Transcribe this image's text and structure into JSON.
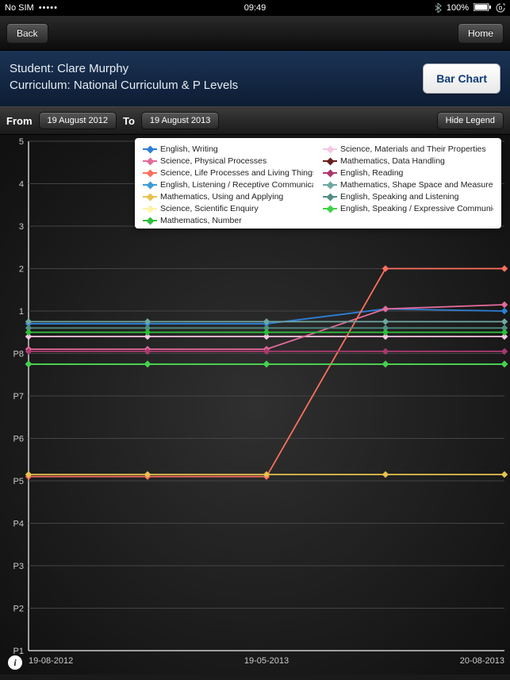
{
  "status": {
    "carrier": "No SIM",
    "time": "09:49",
    "battery": "100%"
  },
  "nav": {
    "back": "Back",
    "home": "Home"
  },
  "header": {
    "student_label": "Student:",
    "student_name": "Clare Murphy",
    "curriculum_label": "Curriculum:",
    "curriculum_name": "National Curriculum & P Levels",
    "bar_chart": "Bar Chart"
  },
  "filter": {
    "from_label": "From",
    "from_date": "19 August 2012",
    "to_label": "To",
    "to_date": "19 August 2013",
    "hide_legend": "Hide Legend"
  },
  "chart_data": {
    "type": "line",
    "ylim": [
      "P1",
      "5"
    ],
    "y_ticks": [
      "P1",
      "P2",
      "P3",
      "P4",
      "P5",
      "P6",
      "P7",
      "P8",
      "1",
      "2",
      "3",
      "4",
      "5"
    ],
    "x_ticks": [
      "19-08-2012",
      "19-05-2013",
      "20-08-2013"
    ],
    "x": [
      0,
      1,
      2,
      3,
      4
    ],
    "series": [
      {
        "name": "English, Writing",
        "color": "#2d7fd6",
        "values": [
          0.7,
          0.7,
          0.7,
          1.05,
          1.0
        ]
      },
      {
        "name": "Science, Materials and Their Properties",
        "color": "#f4c7e2",
        "values": [
          0.4,
          0.4,
          0.4,
          0.4,
          0.4
        ]
      },
      {
        "name": "Science, Physical Processes",
        "color": "#e36b9b",
        "values": [
          0.1,
          0.1,
          0.1,
          1.05,
          1.15
        ]
      },
      {
        "name": "Mathematics, Data Handling",
        "color": "#6b1e1e",
        "values": [
          0.5,
          0.5,
          0.5,
          0.5,
          0.5
        ]
      },
      {
        "name": "Science, Life Processes and Living Things",
        "color": "#ff6f5e",
        "values": [
          -2.9,
          -2.9,
          -2.9,
          2.0,
          2.0
        ]
      },
      {
        "name": "English, Reading",
        "color": "#a83a6e",
        "values": [
          0.05,
          0.05,
          0.05,
          0.05,
          0.05
        ]
      },
      {
        "name": "English, Listening / Receptive Communication",
        "color": "#3d9bd6",
        "values": [
          -0.25,
          -0.25,
          -0.25,
          -0.25,
          -0.25
        ]
      },
      {
        "name": "Mathematics, Shape Space and Measures",
        "color": "#6fa8a0",
        "values": [
          0.75,
          0.75,
          0.75,
          0.75,
          0.75
        ]
      },
      {
        "name": "Mathematics, Using and Applying",
        "color": "#e6c24d",
        "values": [
          -2.85,
          -2.85,
          -2.85,
          -2.85,
          -2.85
        ]
      },
      {
        "name": "English, Speaking and Listening",
        "color": "#4f8f82",
        "values": [
          0.6,
          0.6,
          0.6,
          0.6,
          0.6
        ]
      },
      {
        "name": "Science, Scientific Enquiry",
        "color": "#fff2a8",
        "values": [
          -0.25,
          -0.25,
          -0.25,
          -0.25,
          -0.25
        ]
      },
      {
        "name": "English, Speaking / Expressive Communication",
        "color": "#3fd24a",
        "values": [
          -0.25,
          -0.25,
          -0.25,
          -0.25,
          -0.25
        ]
      },
      {
        "name": "Mathematics, Number",
        "color": "#2bbf3b",
        "values": [
          0.5,
          0.5,
          0.5,
          0.5,
          0.5
        ]
      }
    ]
  }
}
